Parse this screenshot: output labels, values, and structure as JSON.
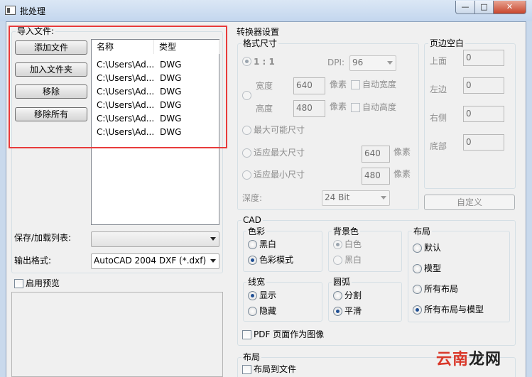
{
  "window": {
    "title": "批处理",
    "min_glyph": "—",
    "max_glyph": "□",
    "close_glyph": "✕"
  },
  "import": {
    "legend": "导入文件:",
    "buttons": {
      "add_file": "添加文件",
      "add_folder": "加入文件夹",
      "remove": "移除",
      "remove_all": "移除所有"
    },
    "columns": {
      "name": "名称",
      "type": "类型"
    },
    "rows": [
      {
        "name": "C:\\Users\\Ad...",
        "type": "DWG"
      },
      {
        "name": "C:\\Users\\Ad...",
        "type": "DWG"
      },
      {
        "name": "C:\\Users\\Ad...",
        "type": "DWG"
      },
      {
        "name": "C:\\Users\\Ad...",
        "type": "DWG"
      },
      {
        "name": "C:\\Users\\Ad...",
        "type": "DWG"
      },
      {
        "name": "C:\\Users\\Ad...",
        "type": "DWG"
      }
    ]
  },
  "save_list": {
    "label": "保存/加载列表:",
    "value": ""
  },
  "output": {
    "label": "输出格式:",
    "value": "AutoCAD 2004 DXF (*.dxf)"
  },
  "preview": {
    "label": "启用预览"
  },
  "converter": {
    "title": "转换器设置",
    "format_size": {
      "legend": "格式尺寸",
      "ratio_label": "1 : 1",
      "dpi_label": "DPI:",
      "dpi_value": "96",
      "width_label": "宽度",
      "width_value": "640",
      "height_label": "高度",
      "height_value": "480",
      "pixel_unit": "像素",
      "auto_width": "自动宽度",
      "auto_height": "自动高度",
      "max_size": "最大可能尺寸",
      "fit_max": "适应最大尺寸",
      "fit_max_value": "640",
      "fit_min": "适应最小尺寸",
      "fit_min_value": "480",
      "depth_label": "深度:",
      "depth_value": "24 Bit"
    },
    "margins": {
      "legend": "页边空白",
      "top": "上面",
      "top_value": "0",
      "left": "左边",
      "left_value": "0",
      "right": "右侧",
      "right_value": "0",
      "bottom": "底部",
      "bottom_value": "0",
      "custom_button": "自定义"
    },
    "cad": {
      "legend": "CAD",
      "color": {
        "legend": "色彩",
        "opt1": "黑白",
        "opt2": "色彩模式"
      },
      "background": {
        "legend": "背景色",
        "opt1": "白色",
        "opt2": "黑白"
      },
      "layout": {
        "legend": "布局",
        "opt1": "默认",
        "opt2": "模型",
        "opt3": "所有布局",
        "opt4": "所有布局与模型"
      },
      "lineweight": {
        "legend": "线宽",
        "opt1": "显示",
        "opt2": "隐藏"
      },
      "arc": {
        "legend": "圆弧",
        "opt1": "分割",
        "opt2": "平滑"
      },
      "pdf_as_image": "PDF 页面作为图像"
    },
    "layout_section": {
      "legend": "布局",
      "layout_to_file": "布局到文件"
    }
  },
  "watermark": {
    "text1": "云南",
    "text2": "龙网"
  }
}
